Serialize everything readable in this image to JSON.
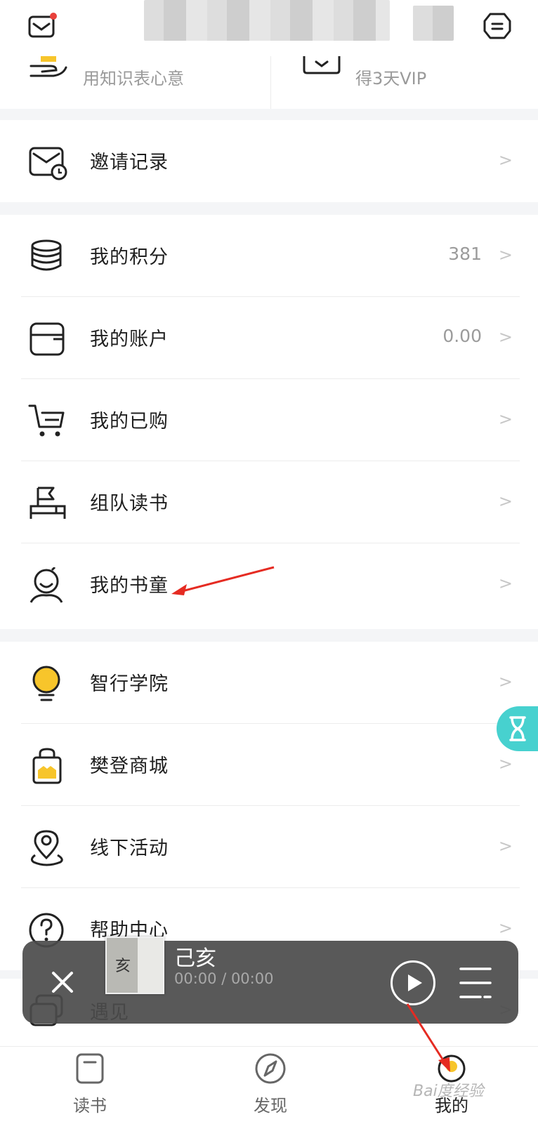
{
  "header": {
    "mail_icon": "mail-icon",
    "settings_icon": "gear-icon"
  },
  "top_cards": [
    {
      "label": "用知识表心意",
      "icon": "gift-hand-icon"
    },
    {
      "label": "得3天VIP",
      "icon": "vip-card-icon"
    }
  ],
  "sections": {
    "invite": [
      {
        "label": "邀请记录",
        "icon": "invite-mail-clock-icon",
        "value": ""
      }
    ],
    "account": [
      {
        "label": "我的积分",
        "icon": "coins-stack-icon",
        "value": "381"
      },
      {
        "label": "我的账户",
        "icon": "wallet-icon",
        "value": "0.00"
      },
      {
        "label": "我的已购",
        "icon": "shopping-cart-icon",
        "value": ""
      },
      {
        "label": "组队读书",
        "icon": "team-reading-icon",
        "value": ""
      },
      {
        "label": "我的书童",
        "icon": "book-boy-icon",
        "value": ""
      }
    ],
    "services": [
      {
        "label": "智行学院",
        "icon": "lightbulb-icon",
        "value": ""
      },
      {
        "label": "樊登商城",
        "icon": "shopping-bag-icon",
        "value": ""
      },
      {
        "label": "线下活动",
        "icon": "location-pin-icon",
        "value": ""
      },
      {
        "label": "帮助中心",
        "icon": "help-icon",
        "value": ""
      },
      {
        "label": "遇见",
        "icon": "meet-chat-icon",
        "value": ""
      }
    ]
  },
  "player": {
    "title": "己亥",
    "time": "00:00 / 00:00",
    "cover_text": "亥",
    "close_icon": "close-icon",
    "play_icon": "play-icon",
    "playlist_icon": "playlist-icon"
  },
  "tabbar": [
    {
      "label": "读书",
      "icon": "book-icon"
    },
    {
      "label": "发现",
      "icon": "compass-icon"
    },
    {
      "label": "我的",
      "icon": "profile-icon"
    }
  ],
  "floating_button": {
    "icon": "hourglass-icon"
  },
  "colors": {
    "accent_yellow": "#f7c52b",
    "teal": "#47d1cf",
    "red_dot": "#e9413b",
    "annotation_red": "#e52b22"
  },
  "watermark": "Bai度经验"
}
